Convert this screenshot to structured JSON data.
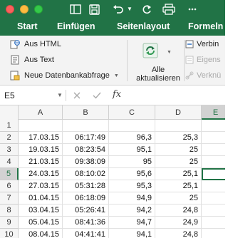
{
  "toolbar": {
    "icons": [
      "close-window",
      "minimize-window",
      "zoom-window",
      "sidebar-icon",
      "save-icon",
      "undo-icon",
      "redo-icon",
      "print-icon"
    ]
  },
  "tabs": [
    {
      "label": "Start"
    },
    {
      "label": "Einfügen"
    },
    {
      "label": "Seitenlayout"
    },
    {
      "label": "Formeln"
    }
  ],
  "ribbon": {
    "external_data": [
      {
        "label": "Aus HTML",
        "icon": "globe-icon"
      },
      {
        "label": "Aus Text",
        "icon": "text-file-icon"
      },
      {
        "label": "Neue Datenbankabfrage",
        "icon": "database-query-icon"
      }
    ],
    "refresh": {
      "line1": "Alle",
      "line2": "aktualisieren"
    },
    "connections": [
      {
        "label": "Verbin"
      },
      {
        "label": "Eigens"
      },
      {
        "label": "Verknü"
      }
    ]
  },
  "formula_bar": {
    "name_box": "E5",
    "fx_label": "fx",
    "formula": ""
  },
  "sheet": {
    "columns": [
      "A",
      "B",
      "C",
      "D",
      "E"
    ],
    "active_column": "E",
    "active_row": "5",
    "rows": [
      {
        "num": "1",
        "cells": [
          "",
          "",
          "",
          ""
        ]
      },
      {
        "num": "2",
        "cells": [
          "17.03.15",
          "06:17:49",
          "96,3",
          "25,3"
        ]
      },
      {
        "num": "3",
        "cells": [
          "19.03.15",
          "08:23:54",
          "95,1",
          "25"
        ]
      },
      {
        "num": "4",
        "cells": [
          "21.03.15",
          "09:38:09",
          "95",
          "25"
        ]
      },
      {
        "num": "5",
        "cells": [
          "24.03.15",
          "08:10:02",
          "95,6",
          "25,1"
        ]
      },
      {
        "num": "6",
        "cells": [
          "27.03.15",
          "05:31:28",
          "95,3",
          "25,1"
        ]
      },
      {
        "num": "7",
        "cells": [
          "01.04.15",
          "06:18:09",
          "94,9",
          "25"
        ]
      },
      {
        "num": "8",
        "cells": [
          "03.04.15",
          "05:26:41",
          "94,2",
          "24,8"
        ]
      },
      {
        "num": "9",
        "cells": [
          "05.04.15",
          "08:41:36",
          "94,7",
          "24,9"
        ]
      },
      {
        "num": "10",
        "cells": [
          "08.04.15",
          "04:41:41",
          "94,1",
          "24,8"
        ]
      }
    ]
  }
}
